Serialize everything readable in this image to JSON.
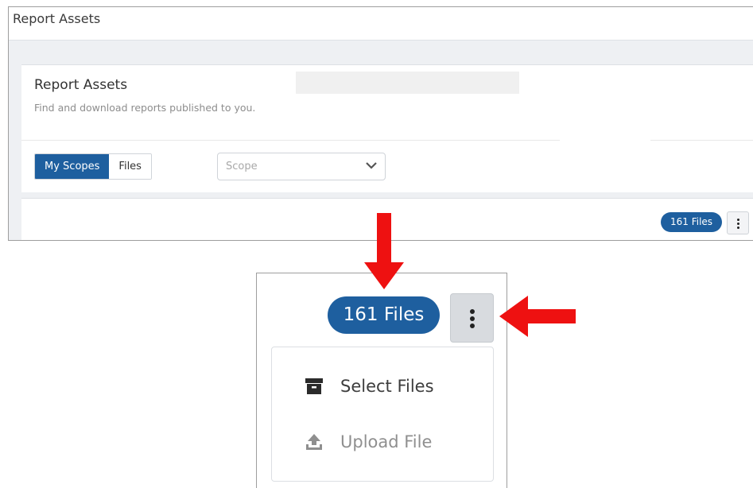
{
  "window": {
    "title": "Report Assets"
  },
  "card": {
    "title": "Report Assets",
    "subtitle": "Find and download reports published to you."
  },
  "toggle": {
    "options": [
      "My Scopes",
      "Files"
    ],
    "active": "My Scopes"
  },
  "scope_select": {
    "placeholder": "Scope",
    "icon": "chevron-down-icon"
  },
  "files": {
    "badge_label": "161 Files",
    "more_icon": "vertical-ellipsis-icon"
  },
  "menu": {
    "items": [
      {
        "label": "Select Files",
        "icon": "archive-box-icon",
        "enabled": true
      },
      {
        "label": "Upload File",
        "icon": "upload-icon",
        "enabled": false
      }
    ]
  },
  "colors": {
    "primary": "#1e5f9f",
    "arrow": "#ee1111",
    "page_bg": "#eef0f3"
  }
}
